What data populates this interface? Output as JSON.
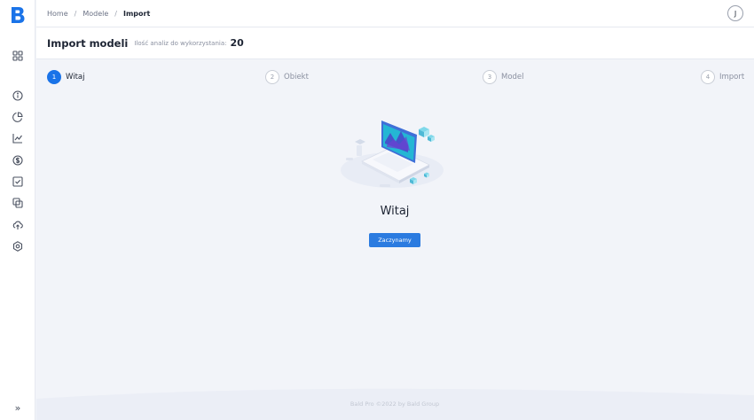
{
  "brand": {
    "logo_letter": "B",
    "color": "#1a73e8"
  },
  "sidebar": {
    "items": [
      {
        "icon": "grid-icon"
      },
      {
        "icon": "info-icon"
      },
      {
        "icon": "pie-chart-icon"
      },
      {
        "icon": "line-chart-icon"
      },
      {
        "icon": "dollar-icon"
      },
      {
        "icon": "checkbox-icon"
      },
      {
        "icon": "copy-icon"
      },
      {
        "icon": "cloud-upload-icon"
      },
      {
        "icon": "settings-icon"
      }
    ],
    "collapse_label": "»"
  },
  "breadcrumb": {
    "home": "Home",
    "models": "Modele",
    "current": "Import"
  },
  "user": {
    "initial": "J"
  },
  "header": {
    "title": "Import modeli",
    "quota_label": "Ilość analiz do wykorzystania:",
    "quota_value": "20"
  },
  "steps": [
    {
      "number": "1",
      "label": "Witaj",
      "active": true
    },
    {
      "number": "2",
      "label": "Obiekt",
      "active": false
    },
    {
      "number": "3",
      "label": "Model",
      "active": false
    },
    {
      "number": "4",
      "label": "Import",
      "active": false
    }
  ],
  "main": {
    "title": "Witaj",
    "button_label": "Zaczynamy"
  },
  "footer": {
    "text": "Bald Pro ©2022 by Bald Group"
  },
  "colors": {
    "accent": "#1a73e8",
    "background": "#f2f4f9"
  }
}
